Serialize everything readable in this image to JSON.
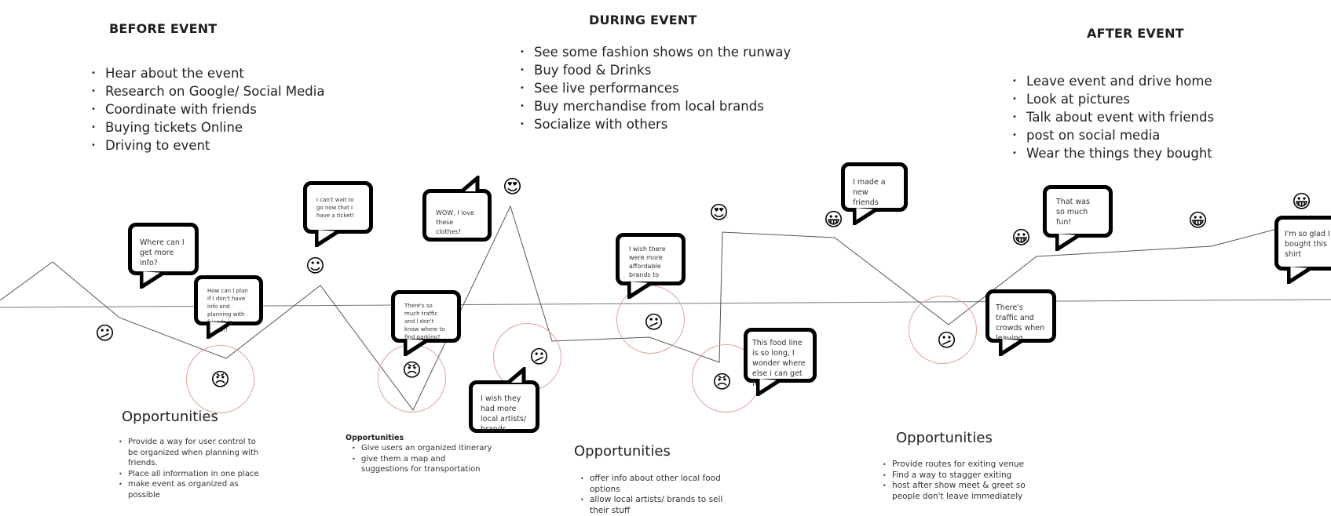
{
  "phases": [
    {
      "title": "BEFORE EVENT",
      "activities": [
        "Hear about the event",
        "Research on Google/ Social Media",
        "Coordinate with friends",
        "Buying tickets Online",
        "Driving to event"
      ]
    },
    {
      "title": "DURING EVENT",
      "activities": [
        "See some fashion shows on the runway",
        "Buy food & Drinks",
        "See live performances",
        "Buy merchandise from local brands",
        "Socialize with others"
      ]
    },
    {
      "title": "AFTER EVENT",
      "activities": [
        "Leave event and drive home",
        "Look at pictures",
        "Talk about event with friends",
        "post on social media",
        "Wear the things they bought"
      ]
    }
  ],
  "thoughts": [
    {
      "text": "Where can I get more info?"
    },
    {
      "text": "How can I plan if I don't have info and planning with friends is HARD!!"
    },
    {
      "text": "I can't wait to go now that I have a ticket!"
    },
    {
      "text": "There's so much traffic and I don't know where to find parking?"
    },
    {
      "text": "WOW, I love these clothes!"
    },
    {
      "text": "I wish they had more local artists/ brands"
    },
    {
      "text": "I wish there were more affordable brands to buy"
    },
    {
      "text": "This food line is so long, I wonder where else i can get food"
    },
    {
      "text": "I made a new friends"
    },
    {
      "text": "There's traffic and crowds when leaving"
    },
    {
      "text": "That was so much fun!"
    },
    {
      "text": "I'm so glad I bought this shirt"
    }
  ],
  "emotions": [
    {
      "icon": "neutral-face-icon",
      "glyph": "😕"
    },
    {
      "icon": "angry-face-icon",
      "glyph": "😠"
    },
    {
      "icon": "smiling-face-icon",
      "glyph": "☺"
    },
    {
      "icon": "angry-face-icon",
      "glyph": "😠"
    },
    {
      "icon": "neutral-face-icon",
      "glyph": "😕"
    },
    {
      "icon": "heart-eyes-face-icon",
      "glyph": "😍"
    },
    {
      "icon": "neutral-face-icon",
      "glyph": "😕"
    },
    {
      "icon": "angry-face-icon",
      "glyph": "😠"
    },
    {
      "icon": "heart-eyes-face-icon",
      "glyph": "😍"
    },
    {
      "icon": "grinning-face-icon",
      "glyph": "😀"
    },
    {
      "icon": "neutral-face-icon",
      "glyph": "😕"
    },
    {
      "icon": "grinning-face-icon",
      "glyph": "😀"
    },
    {
      "icon": "grinning-face-icon",
      "glyph": "😀"
    },
    {
      "icon": "grinning-face-icon",
      "glyph": "😀"
    }
  ],
  "opportunities": [
    {
      "title": "Opportunities",
      "items": [
        "Provide a way for user control to be organized when planning with friends.",
        "Place all information in one place",
        "make event as organized as possible"
      ]
    },
    {
      "title": "Opportunities",
      "items": [
        "Give users an organized itinerary",
        "give them a map and suggestions for transportation"
      ]
    },
    {
      "title": "Opportunities",
      "items": [
        "offer info about other local food options",
        "allow local artists/ brands to sell their stuff"
      ]
    },
    {
      "title": "Opportunities",
      "items": [
        "Provide routes for exiting venue",
        "Find a way to stagger exiting",
        "host after show meet & greet so people don't leave immediately"
      ]
    }
  ],
  "colors": {
    "pain_ring": "#e0a49a",
    "line": "#555555",
    "baseline": "#777777"
  }
}
